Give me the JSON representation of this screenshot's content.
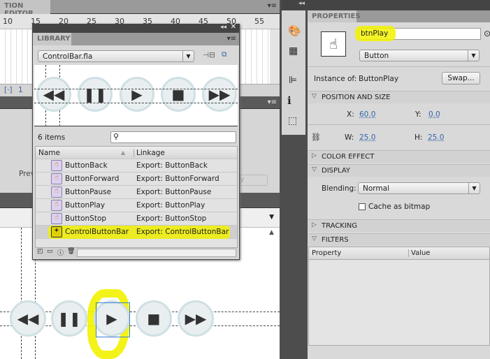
{
  "motion_editor": {
    "title": "TION EDITOR",
    "ruler": [
      "10",
      "15",
      "20",
      "25",
      "30",
      "35",
      "40",
      "45",
      "50",
      "55"
    ],
    "frame": "1"
  },
  "lower_panel": {
    "preview_label": "Prev",
    "apply_label": "pply"
  },
  "library": {
    "title": "LIBRARY",
    "file": "ControlBar.fla",
    "item_count": "6 items",
    "search_placeholder": "",
    "columns": {
      "name": "Name",
      "linkage": "Linkage"
    },
    "items": [
      {
        "name": "ButtonBack",
        "linkage": "Export: ButtonBack",
        "icon": "button-symbol-icon"
      },
      {
        "name": "ButtonForward",
        "linkage": "Export: ButtonForward",
        "icon": "button-symbol-icon"
      },
      {
        "name": "ButtonPause",
        "linkage": "Export: ButtonPause",
        "icon": "button-symbol-icon"
      },
      {
        "name": "ButtonPlay",
        "linkage": "Export: ButtonPlay",
        "icon": "button-symbol-icon"
      },
      {
        "name": "ButtonStop",
        "linkage": "Export: ButtonStop",
        "icon": "button-symbol-icon"
      },
      {
        "name": "ControlButtonBar",
        "linkage": "Export: ControlButtonBar",
        "icon": "movieclip-symbol-icon",
        "selected": true
      }
    ]
  },
  "properties": {
    "title": "PROPERTIES",
    "instance_name": "btnPlay",
    "symbol_type": "Button",
    "instance_of_label": "Instance of:",
    "instance_of": "ButtonPlay",
    "swap_label": "Swap...",
    "position_size": {
      "title": "POSITION AND SIZE",
      "x_label": "X:",
      "x": "60.0",
      "y_label": "Y:",
      "y": "0.0",
      "w_label": "W:",
      "w": "25.0",
      "h_label": "H:",
      "h": "25.0"
    },
    "color_effect": "COLOR EFFECT",
    "display": {
      "title": "DISPLAY",
      "blending_label": "Blending:",
      "blending": "Normal",
      "cache_label": "Cache as bitmap",
      "cache_checked": false
    },
    "tracking": "TRACKING",
    "filters": {
      "title": "FILTERS",
      "columns": [
        "Property",
        "Value"
      ]
    }
  },
  "colors": {
    "highlight": "#f2f200",
    "selection": "#3a7fd0",
    "panel": "#d9d9d9"
  }
}
